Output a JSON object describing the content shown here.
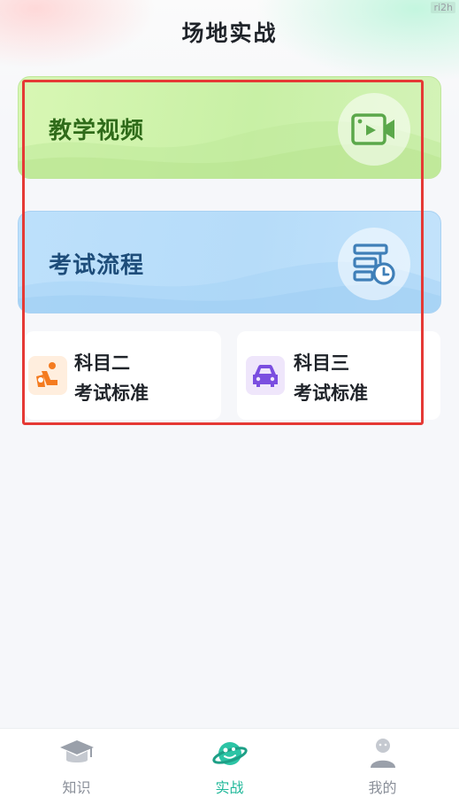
{
  "header": {
    "title": "场地实战",
    "watermark": "ri2h"
  },
  "banners": [
    {
      "label": "教学视频",
      "icon": "video-icon",
      "color": "#c8f0a5"
    },
    {
      "label": "考试流程",
      "icon": "flowchart-icon",
      "color": "#b6dcf9"
    }
  ],
  "cards": [
    {
      "title": "科目二",
      "subtitle": "考试标准",
      "icon": "driver-seat-icon",
      "accent": "#f47b20"
    },
    {
      "title": "科目三",
      "subtitle": "考试标准",
      "icon": "car-icon",
      "accent": "#7b4ee0"
    }
  ],
  "tabbar": {
    "items": [
      {
        "label": "知识",
        "icon": "graduation-cap-icon",
        "active": false
      },
      {
        "label": "实战",
        "icon": "planet-icon",
        "active": true
      },
      {
        "label": "我的",
        "icon": "user-icon",
        "active": false
      }
    ]
  },
  "colors": {
    "active_tab": "#21b89a",
    "inactive_tab": "#8a8f99",
    "highlight_frame": "#e53935"
  }
}
